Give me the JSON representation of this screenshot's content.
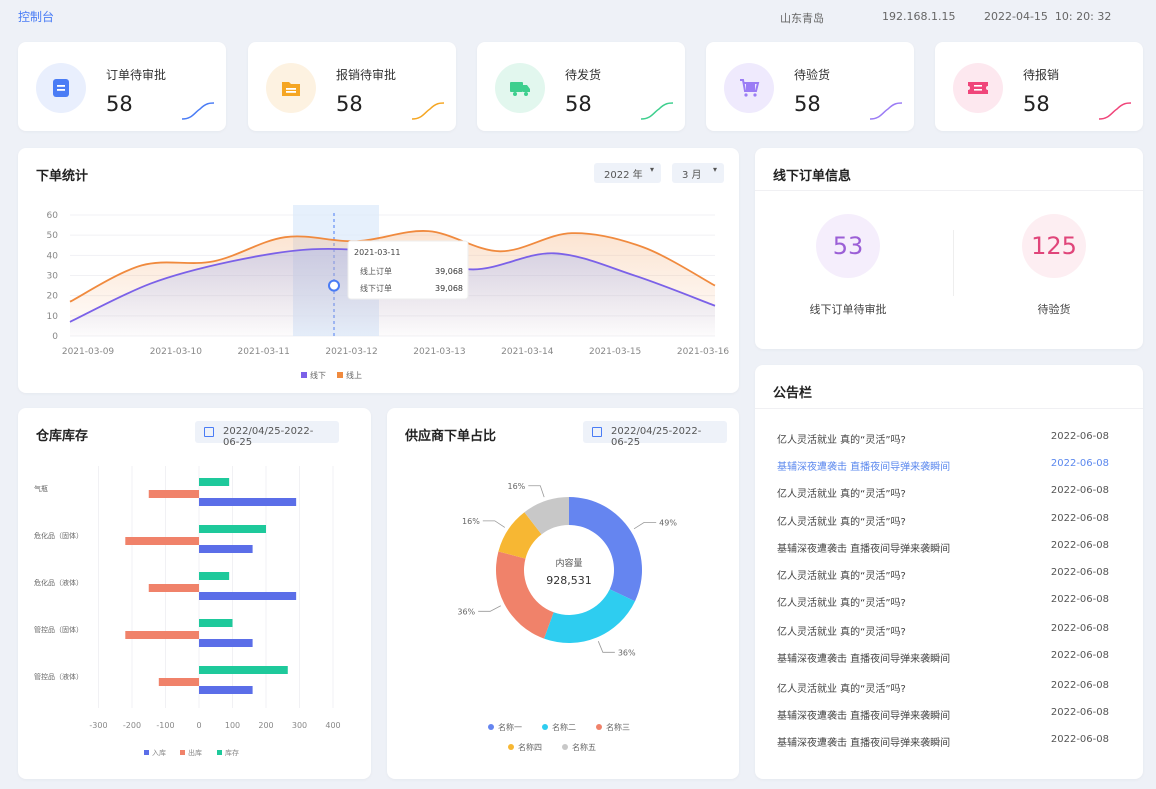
{
  "header": {
    "breadcrumb": "控制台",
    "location": "山东青岛",
    "ip": "192.168.1.15",
    "datetime": "2022-04-15  10: 20: 32"
  },
  "stats": [
    {
      "label": "订单待审批",
      "value": "58",
      "icon": "document-icon",
      "color": "#4a7cf5",
      "bg": "#e9effd"
    },
    {
      "label": "报销待审批",
      "value": "58",
      "icon": "folder-icon",
      "color": "#f5a623",
      "bg": "#fdf2e1"
    },
    {
      "label": "待发货",
      "value": "58",
      "icon": "truck-icon",
      "color": "#3ecf8e",
      "bg": "#e2f7ee"
    },
    {
      "label": "待验货",
      "value": "58",
      "icon": "cart-icon",
      "color": "#9b7cf5",
      "bg": "#efeafd"
    },
    {
      "label": "待报销",
      "value": "58",
      "icon": "ticket-icon",
      "color": "#f0457a",
      "bg": "#fde8ef"
    }
  ],
  "order_stats": {
    "title": "下单统计",
    "year_select": "2022 年",
    "month_select": "3 月",
    "tooltip": {
      "date": "2021-03-11",
      "rows": [
        {
          "label": "线上订单",
          "value": "39,068"
        },
        {
          "label": "线下订单",
          "value": "39,068"
        }
      ]
    }
  },
  "offline": {
    "title": "线下订单信息",
    "items": [
      {
        "value": "53",
        "label": "线下订单待审批",
        "color": "#9b5fd6",
        "bg": "#f5eefc"
      },
      {
        "value": "125",
        "label": "待验货",
        "color": "#e0457a",
        "bg": "#fdeef2"
      }
    ]
  },
  "notice": {
    "title": "公告栏",
    "items": [
      {
        "text": "亿人灵活就业 真的“灵活”吗?",
        "date": "2022-06-08",
        "active": false
      },
      {
        "text": "基辅深夜遭袭击 直播夜间导弹来袭瞬间",
        "date": "2022-06-08",
        "active": true
      },
      {
        "text": "亿人灵活就业 真的“灵活”吗?",
        "date": "2022-06-08",
        "active": false
      },
      {
        "text": "亿人灵活就业 真的“灵活”吗?",
        "date": "2022-06-08",
        "active": false
      },
      {
        "text": "基辅深夜遭袭击 直播夜间导弹来袭瞬间",
        "date": "2022-06-08",
        "active": false
      },
      {
        "text": "亿人灵活就业 真的“灵活”吗?",
        "date": "2022-06-08",
        "active": false
      },
      {
        "text": "亿人灵活就业 真的“灵活”吗?",
        "date": "2022-06-08",
        "active": false
      },
      {
        "text": "亿人灵活就业 真的“灵活”吗?",
        "date": "2022-06-08",
        "active": false
      },
      {
        "text": "基辅深夜遭袭击 直播夜间导弹来袭瞬间",
        "date": "2022-06-08",
        "active": false
      },
      {
        "text": "亿人灵活就业 真的“灵活”吗?",
        "date": "2022-06-08",
        "active": false
      },
      {
        "text": "基辅深夜遭袭击 直播夜间导弹来袭瞬间",
        "date": "2022-06-08",
        "active": false
      },
      {
        "text": "基辅深夜遭袭击 直播夜间导弹来袭瞬间",
        "date": "2022-06-08",
        "active": false
      }
    ]
  },
  "warehouse": {
    "title": "仓库库存",
    "date_range": "2022/04/25-2022-06-25"
  },
  "supplier": {
    "title": "供应商下单占比",
    "date_range": "2022/04/25-2022-06-25",
    "center_label": "内容量",
    "center_value": "928,531"
  },
  "chart_data": [
    {
      "type": "line",
      "x": [
        "2021-03-09",
        "2021-03-10",
        "2021-03-11",
        "2021-03-12",
        "2021-03-13",
        "2021-03-14",
        "2021-03-15",
        "2021-03-16"
      ],
      "series": [
        {
          "name": "线下",
          "color": "#7b61e8",
          "values": [
            7,
            26,
            37,
            43,
            41,
            33,
            41,
            30,
            15
          ]
        },
        {
          "name": "线上",
          "color": "#f08a3e",
          "values": [
            17,
            35,
            37,
            49,
            47,
            52,
            42,
            51,
            44,
            25
          ]
        }
      ],
      "ylim": [
        0,
        60
      ],
      "yticks": [
        0,
        10,
        20,
        30,
        40,
        50,
        60
      ],
      "legend": "bottom"
    },
    {
      "type": "bar",
      "orientation": "horizontal",
      "categories": [
        "气瓶",
        "危化品（固体）",
        "危化品（液体）",
        "管控品（固体）",
        "管控品（液体）"
      ],
      "series": [
        {
          "name": "入库",
          "color": "#5b6ee8",
          "values": [
            290,
            160,
            290,
            160,
            160
          ]
        },
        {
          "name": "出库",
          "color": "#f0826a",
          "values": [
            -150,
            -220,
            -150,
            -220,
            -120
          ]
        },
        {
          "name": "库存",
          "color": "#1ec99b",
          "values": [
            90,
            200,
            90,
            100,
            265
          ]
        }
      ],
      "xlim": [
        -300,
        400
      ],
      "xticks": [
        -300,
        -200,
        -100,
        0,
        100,
        200,
        300,
        400
      ],
      "legend": "bottom"
    },
    {
      "type": "pie",
      "labels": [
        "名称一",
        "名称二",
        "名称三",
        "名称四",
        "名称五"
      ],
      "values": [
        49,
        36,
        36,
        16,
        16
      ],
      "value_labels": [
        "49%",
        "36%",
        "36%",
        "16%",
        "16%"
      ],
      "colors": [
        "#6585f0",
        "#2ecdf0",
        "#f0826a",
        "#f7b733",
        "#c8c8c8"
      ],
      "legend": "bottom"
    }
  ]
}
